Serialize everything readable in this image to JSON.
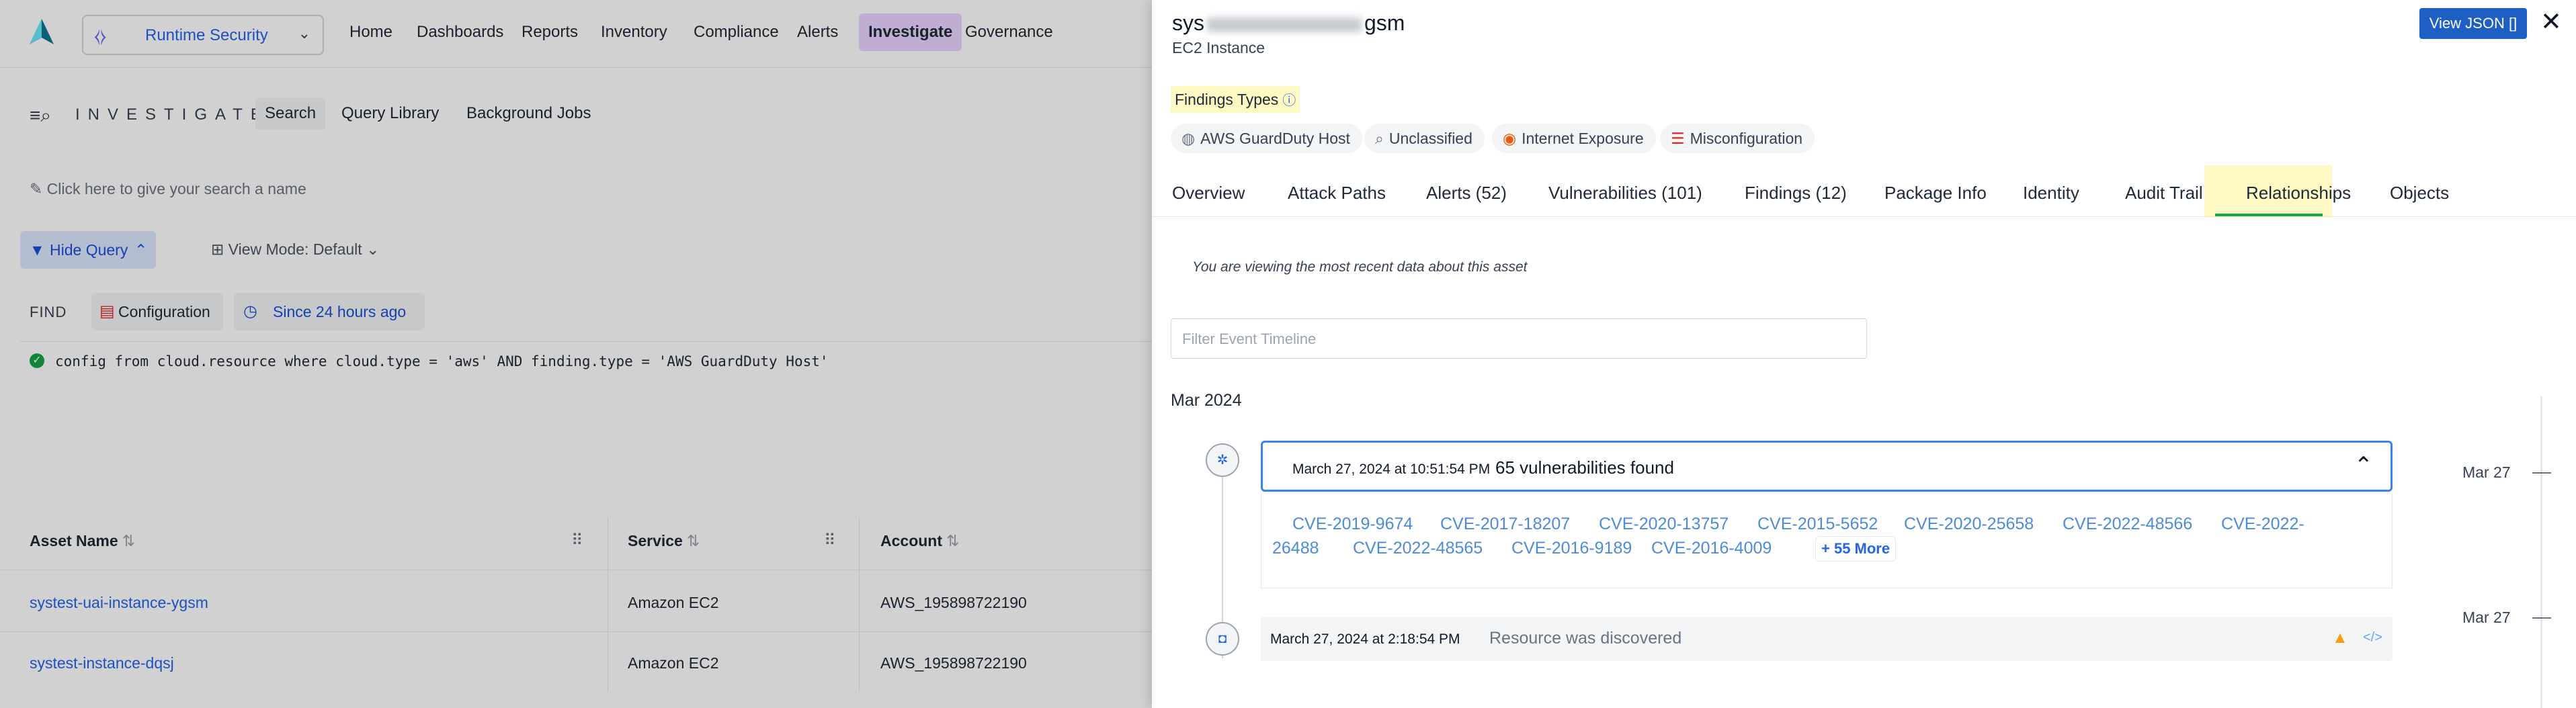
{
  "app": {
    "product_name": "Runtime Security",
    "nav": [
      "Home",
      "Dashboards",
      "Reports",
      "Inventory",
      "Compliance",
      "Alerts",
      "Investigate",
      "Governance"
    ],
    "active_nav": "Investigate",
    "section_title": "INVESTIGATE",
    "subtabs": [
      "Search",
      "Query Library",
      "Background Jobs"
    ],
    "search_name_placeholder": "Click here to give your search a name",
    "hide_query_label": "Hide Query",
    "view_mode_label": "View Mode: Default",
    "find_label": "FIND",
    "find_chip": "Configuration",
    "time_chip": "Since 24 hours ago",
    "query": "config from cloud.resource where cloud.type = 'aws' AND finding.type = 'AWS GuardDuty Host'",
    "table": {
      "columns": [
        "Asset Name",
        "Service",
        "Account"
      ],
      "rows": [
        {
          "asset": "systest-uai-instance-ygsm",
          "service": "Amazon EC2",
          "account": "AWS_195898722190"
        },
        {
          "asset": "systest-instance-dqsj",
          "service": "Amazon EC2",
          "account": "AWS_195898722190"
        }
      ]
    }
  },
  "drawer": {
    "title_prefix": "sys",
    "title_suffix": "gsm",
    "subtitle": "EC2 Instance",
    "view_json_label": "View JSON []",
    "close_glyph": "✕",
    "findings_types_label": "Findings Types",
    "finding_tags": [
      "AWS GuardDuty Host",
      "Unclassified",
      "Internet Exposure",
      "Misconfiguration"
    ],
    "tabs": [
      "Overview",
      "Attack Paths",
      "Alerts (52)",
      "Vulnerabilities (101)",
      "Findings (12)",
      "Package Info",
      "Identity",
      "Audit Trail",
      "Relationships",
      "Objects"
    ],
    "active_tab": "Audit Trail",
    "recent_note": "You are viewing the most recent data about this asset",
    "filter_placeholder": "Filter Event Timeline",
    "month": "Mar 2024",
    "events": [
      {
        "timestamp": "March 27, 2024 at 10:51:54 PM",
        "text": "65 vulnerabilities found",
        "side_date": "Mar 27",
        "cves": [
          "CVE-2019-9674",
          "CVE-2017-18207",
          "CVE-2020-13757",
          "CVE-2015-5652",
          "CVE-2020-25658",
          "CVE-2022-48566",
          "CVE-2022-",
          "26488",
          "CVE-2022-48565",
          "CVE-2016-9189",
          "CVE-2016-4009"
        ],
        "more_label": "+ 55 More"
      },
      {
        "timestamp": "March 27, 2024 at 2:18:54 PM",
        "text": "Resource was discovered",
        "side_date": "Mar 27"
      }
    ]
  },
  "colors": {
    "accent_blue": "#1d5fc4",
    "active_nav_bg": "#e9d5ff",
    "highlight_yellow": "#fef9c3",
    "active_tab_underline": "#16a34a",
    "event_border": "#3b82f6"
  }
}
